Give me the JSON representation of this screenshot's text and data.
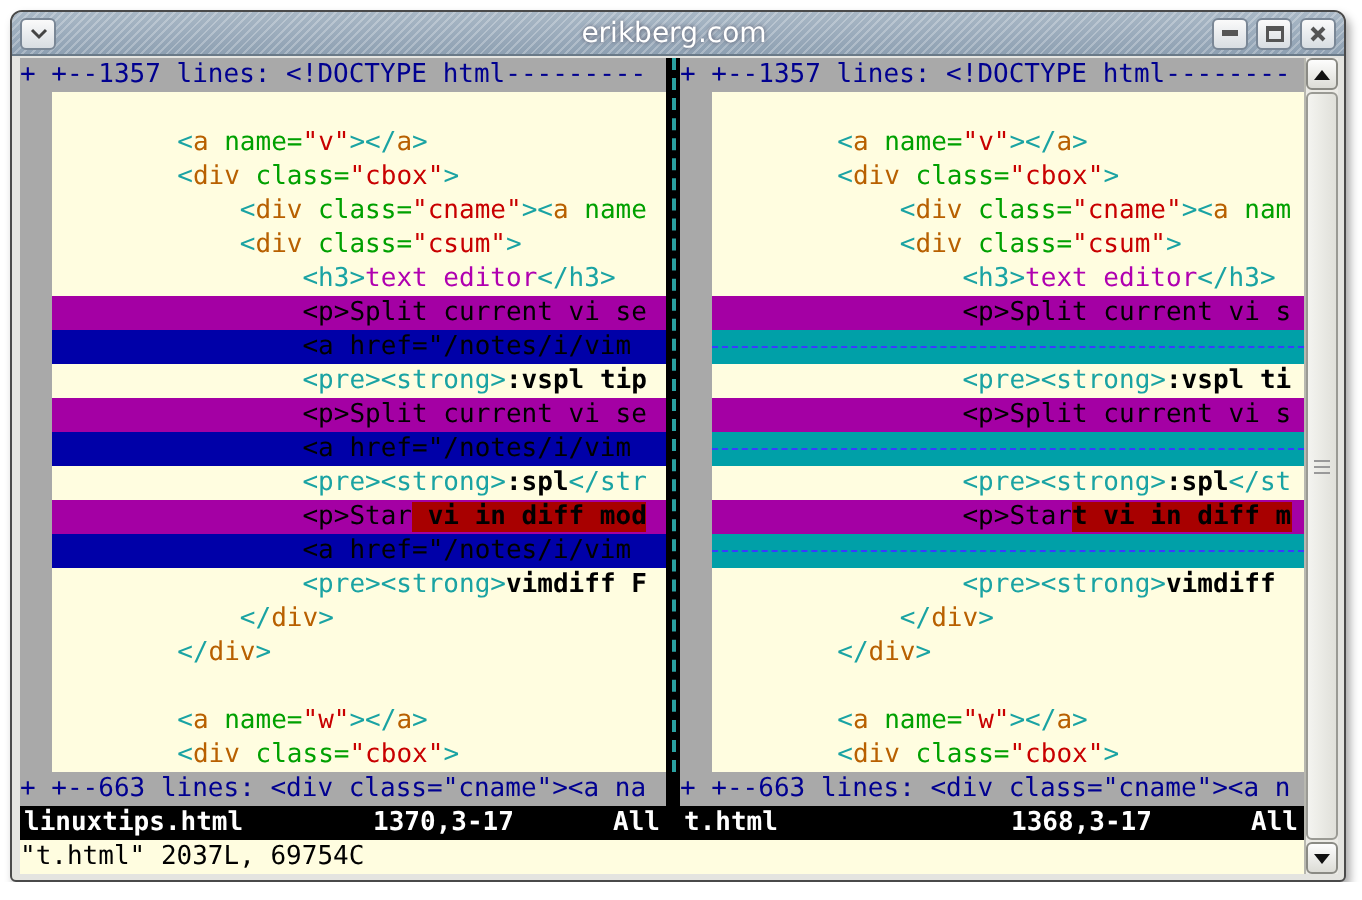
{
  "window": {
    "title": "erikberg.com"
  },
  "panes": [
    {
      "fold_top": "+ +--1357 lines: <!DOCTYPE html---------",
      "lines": [
        {
          "kind": "normal"
        },
        {
          "kind": "normal",
          "segments": [
            {
              "text": "        <",
              "kind": "punct"
            },
            {
              "text": "a",
              "kind": "tag"
            },
            {
              "text": " name=",
              "kind": "attr"
            },
            {
              "text": "\"v\"",
              "kind": "string"
            },
            {
              "text": "></",
              "kind": "punct"
            },
            {
              "text": "a",
              "kind": "tag"
            },
            {
              "text": ">",
              "kind": "punct"
            }
          ]
        },
        {
          "kind": "normal",
          "segments": [
            {
              "text": "        <",
              "kind": "punct"
            },
            {
              "text": "div",
              "kind": "tag"
            },
            {
              "text": " class=",
              "kind": "attr"
            },
            {
              "text": "\"cbox\"",
              "kind": "string"
            },
            {
              "text": ">",
              "kind": "punct"
            }
          ]
        },
        {
          "kind": "normal",
          "segments": [
            {
              "text": "            <",
              "kind": "punct"
            },
            {
              "text": "div",
              "kind": "tag"
            },
            {
              "text": " class=",
              "kind": "attr"
            },
            {
              "text": "\"cname\"",
              "kind": "string"
            },
            {
              "text": "><",
              "kind": "punct"
            },
            {
              "text": "a",
              "kind": "tag"
            },
            {
              "text": " name",
              "kind": "attr"
            }
          ]
        },
        {
          "kind": "normal",
          "segments": [
            {
              "text": "            <",
              "kind": "punct"
            },
            {
              "text": "div",
              "kind": "tag"
            },
            {
              "text": " class=",
              "kind": "attr"
            },
            {
              "text": "\"csum\"",
              "kind": "string"
            },
            {
              "text": ">",
              "kind": "punct"
            }
          ]
        },
        {
          "kind": "normal",
          "segments": [
            {
              "text": "                <h3>",
              "kind": "punct"
            },
            {
              "text": "text editor",
              "kind": "title"
            },
            {
              "text": "</h3>",
              "kind": "punct"
            }
          ]
        },
        {
          "kind": "changed",
          "segments": [
            {
              "text": "                <p>Split current vi se",
              "kind": "plain"
            }
          ]
        },
        {
          "kind": "added",
          "segments": [
            {
              "text": "                <a href=\"/notes/i/vim",
              "kind": "plain"
            }
          ]
        },
        {
          "kind": "normal",
          "segments": [
            {
              "text": "                <pre><strong>",
              "kind": "punct"
            },
            {
              "text": ":vspl tip",
              "kind": "strong"
            }
          ]
        },
        {
          "kind": "changed",
          "segments": [
            {
              "text": "                <p>Split current vi se",
              "kind": "plain"
            }
          ]
        },
        {
          "kind": "added",
          "segments": [
            {
              "text": "                <a href=\"/notes/i/vim",
              "kind": "plain"
            }
          ]
        },
        {
          "kind": "normal",
          "segments": [
            {
              "text": "                <pre><strong>",
              "kind": "punct"
            },
            {
              "text": ":spl",
              "kind": "strong"
            },
            {
              "text": "</str",
              "kind": "punct"
            }
          ]
        },
        {
          "kind": "changed",
          "segments": [
            {
              "text": "                <p>Star",
              "kind": "plain"
            },
            {
              "text": " vi in diff mod",
              "kind": "difftext"
            }
          ]
        },
        {
          "kind": "added",
          "segments": [
            {
              "text": "                <a href=\"/notes/i/vim",
              "kind": "plain"
            }
          ]
        },
        {
          "kind": "normal",
          "segments": [
            {
              "text": "                <pre><strong>",
              "kind": "punct"
            },
            {
              "text": "vimdiff F",
              "kind": "strong"
            }
          ]
        },
        {
          "kind": "normal",
          "segments": [
            {
              "text": "            </",
              "kind": "punct"
            },
            {
              "text": "div",
              "kind": "tag"
            },
            {
              "text": ">",
              "kind": "punct"
            }
          ]
        },
        {
          "kind": "normal",
          "segments": [
            {
              "text": "        </",
              "kind": "punct"
            },
            {
              "text": "div",
              "kind": "tag"
            },
            {
              "text": ">",
              "kind": "punct"
            }
          ]
        },
        {
          "kind": "normal"
        },
        {
          "kind": "normal",
          "segments": [
            {
              "text": "        <",
              "kind": "punct"
            },
            {
              "text": "a",
              "kind": "tag"
            },
            {
              "text": " name=",
              "kind": "attr"
            },
            {
              "text": "\"w\"",
              "kind": "string"
            },
            {
              "text": "></",
              "kind": "punct"
            },
            {
              "text": "a",
              "kind": "tag"
            },
            {
              "text": ">",
              "kind": "punct"
            }
          ]
        },
        {
          "kind": "normal",
          "segments": [
            {
              "text": "        <",
              "kind": "punct"
            },
            {
              "text": "div",
              "kind": "tag"
            },
            {
              "text": " class=",
              "kind": "attr"
            },
            {
              "text": "\"cbox\"",
              "kind": "string"
            },
            {
              "text": ">",
              "kind": "punct"
            }
          ]
        }
      ],
      "fold_bottom": "+ +--663 lines: <div class=\"cname\"><a na",
      "status": {
        "file": "linuxtips.html",
        "position": "1370,3-17",
        "scroll": "All"
      }
    },
    {
      "fold_top": "+ +--1357 lines: <!DOCTYPE html--------",
      "lines": [
        {
          "kind": "normal"
        },
        {
          "kind": "normal",
          "segments": [
            {
              "text": "        <",
              "kind": "punct"
            },
            {
              "text": "a",
              "kind": "tag"
            },
            {
              "text": " name=",
              "kind": "attr"
            },
            {
              "text": "\"v\"",
              "kind": "string"
            },
            {
              "text": "></",
              "kind": "punct"
            },
            {
              "text": "a",
              "kind": "tag"
            },
            {
              "text": ">",
              "kind": "punct"
            }
          ]
        },
        {
          "kind": "normal",
          "segments": [
            {
              "text": "        <",
              "kind": "punct"
            },
            {
              "text": "div",
              "kind": "tag"
            },
            {
              "text": " class=",
              "kind": "attr"
            },
            {
              "text": "\"cbox\"",
              "kind": "string"
            },
            {
              "text": ">",
              "kind": "punct"
            }
          ]
        },
        {
          "kind": "normal",
          "segments": [
            {
              "text": "            <",
              "kind": "punct"
            },
            {
              "text": "div",
              "kind": "tag"
            },
            {
              "text": " class=",
              "kind": "attr"
            },
            {
              "text": "\"cname\"",
              "kind": "string"
            },
            {
              "text": "><",
              "kind": "punct"
            },
            {
              "text": "a",
              "kind": "tag"
            },
            {
              "text": " nam",
              "kind": "attr"
            }
          ]
        },
        {
          "kind": "normal",
          "segments": [
            {
              "text": "            <",
              "kind": "punct"
            },
            {
              "text": "div",
              "kind": "tag"
            },
            {
              "text": " class=",
              "kind": "attr"
            },
            {
              "text": "\"csum\"",
              "kind": "string"
            },
            {
              "text": ">",
              "kind": "punct"
            }
          ]
        },
        {
          "kind": "normal",
          "segments": [
            {
              "text": "                <h3>",
              "kind": "punct"
            },
            {
              "text": "text editor",
              "kind": "title"
            },
            {
              "text": "</h3>",
              "kind": "punct"
            }
          ]
        },
        {
          "kind": "changed",
          "segments": [
            {
              "text": "                <p>Split current vi s",
              "kind": "plain"
            }
          ]
        },
        {
          "kind": "filler"
        },
        {
          "kind": "normal",
          "segments": [
            {
              "text": "                <pre><strong>",
              "kind": "punct"
            },
            {
              "text": ":vspl ti",
              "kind": "strong"
            }
          ]
        },
        {
          "kind": "changed",
          "segments": [
            {
              "text": "                <p>Split current vi s",
              "kind": "plain"
            }
          ]
        },
        {
          "kind": "filler"
        },
        {
          "kind": "normal",
          "segments": [
            {
              "text": "                <pre><strong>",
              "kind": "punct"
            },
            {
              "text": ":spl",
              "kind": "strong"
            },
            {
              "text": "</st",
              "kind": "punct"
            }
          ]
        },
        {
          "kind": "changed",
          "segments": [
            {
              "text": "                <p>Star",
              "kind": "plain"
            },
            {
              "text": "t vi in diff m",
              "kind": "difftext"
            }
          ]
        },
        {
          "kind": "filler"
        },
        {
          "kind": "normal",
          "segments": [
            {
              "text": "                <pre><strong>",
              "kind": "punct"
            },
            {
              "text": "vimdiff",
              "kind": "strong"
            }
          ]
        },
        {
          "kind": "normal",
          "segments": [
            {
              "text": "            </",
              "kind": "punct"
            },
            {
              "text": "div",
              "kind": "tag"
            },
            {
              "text": ">",
              "kind": "punct"
            }
          ]
        },
        {
          "kind": "normal",
          "segments": [
            {
              "text": "        </",
              "kind": "punct"
            },
            {
              "text": "div",
              "kind": "tag"
            },
            {
              "text": ">",
              "kind": "punct"
            }
          ]
        },
        {
          "kind": "normal"
        },
        {
          "kind": "normal",
          "segments": [
            {
              "text": "        <",
              "kind": "punct"
            },
            {
              "text": "a",
              "kind": "tag"
            },
            {
              "text": " name=",
              "kind": "attr"
            },
            {
              "text": "\"w\"",
              "kind": "string"
            },
            {
              "text": "></",
              "kind": "punct"
            },
            {
              "text": "a",
              "kind": "tag"
            },
            {
              "text": ">",
              "kind": "punct"
            }
          ]
        },
        {
          "kind": "normal",
          "segments": [
            {
              "text": "        <",
              "kind": "punct"
            },
            {
              "text": "div",
              "kind": "tag"
            },
            {
              "text": " class=",
              "kind": "attr"
            },
            {
              "text": "\"cbox\"",
              "kind": "string"
            },
            {
              "text": ">",
              "kind": "punct"
            }
          ]
        }
      ],
      "fold_bottom": "+ +--663 lines: <div class=\"cname\"><a n",
      "status": {
        "file": "t.html",
        "position": "1368,3-17",
        "scroll": "All"
      }
    }
  ],
  "command_line": "\"t.html\" 2037L, 69754C"
}
